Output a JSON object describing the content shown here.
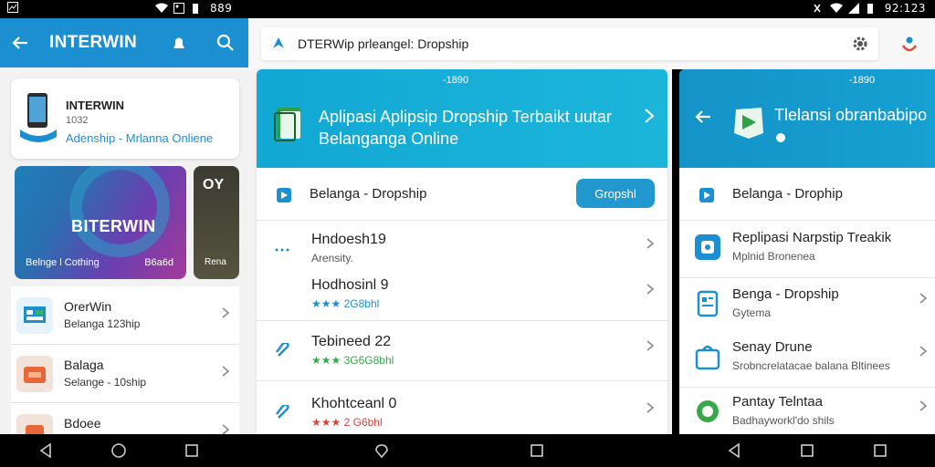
{
  "status_bar": {
    "left_text": "889",
    "right_text": "92:123"
  },
  "left_panel": {
    "app_title": "INTERWIN",
    "card": {
      "title": "INTERWIN",
      "subtitle": "1032",
      "link": "Adenship - Mrlanna Onliene"
    },
    "promo": {
      "brand": "BITERWIN",
      "caption_left": "Belnge l Cothing",
      "caption_right": "B6a6d"
    },
    "promo2": {
      "title": "OY",
      "caption": "Rena"
    },
    "items": [
      {
        "title": "OrerWin",
        "subtitle": "Belanga 123hip"
      },
      {
        "title": "Balaga",
        "subtitle": "Selange - 10ship"
      },
      {
        "title": "Bdoee",
        "subtitle": ""
      }
    ]
  },
  "search": {
    "text": "DTERWip рrleangel: Dropship"
  },
  "middle_panel": {
    "version": "-1890",
    "banner_title": "Aplipasi Aplipsip Dropship Terbaikt uutar Belanganga Online",
    "head_label": "Belanga - Dropship",
    "head_button": "Gropshl",
    "entries": [
      {
        "title": "Hndoesh19",
        "subtitle": "Arensity.",
        "stars": ""
      },
      {
        "title": "Hodhosinl 9",
        "subtitle": "",
        "stars": "★★★ 2G8bhl"
      },
      {
        "title": "Tebineed 22",
        "subtitle": "",
        "stars": "★★★ 3G6G8bhl"
      },
      {
        "title": "Khohtceanl 0",
        "subtitle": "",
        "stars": "★★★ 2 G6bhl"
      }
    ]
  },
  "right_panel": {
    "version": "-1890",
    "banner_title": "Tlelansi obranbabipo",
    "head_label": "Belanga - Drophip",
    "items": [
      {
        "title": "Replipasi Narpstip Treakik",
        "subtitle": "Mplnid Bronenea"
      },
      {
        "title": "Benga - Dropship",
        "subtitle": "Gytema"
      },
      {
        "title": "Senay Drune",
        "subtitle": "Srobncrelatacae balana Bltinees"
      },
      {
        "title": "Pantay Telntaa",
        "subtitle": "Badhayworkl'do shils"
      }
    ]
  },
  "colors": {
    "primary_blue": "#1b8fd0",
    "banner_teal": "#12a7d4",
    "button_blue": "#2199cf"
  }
}
